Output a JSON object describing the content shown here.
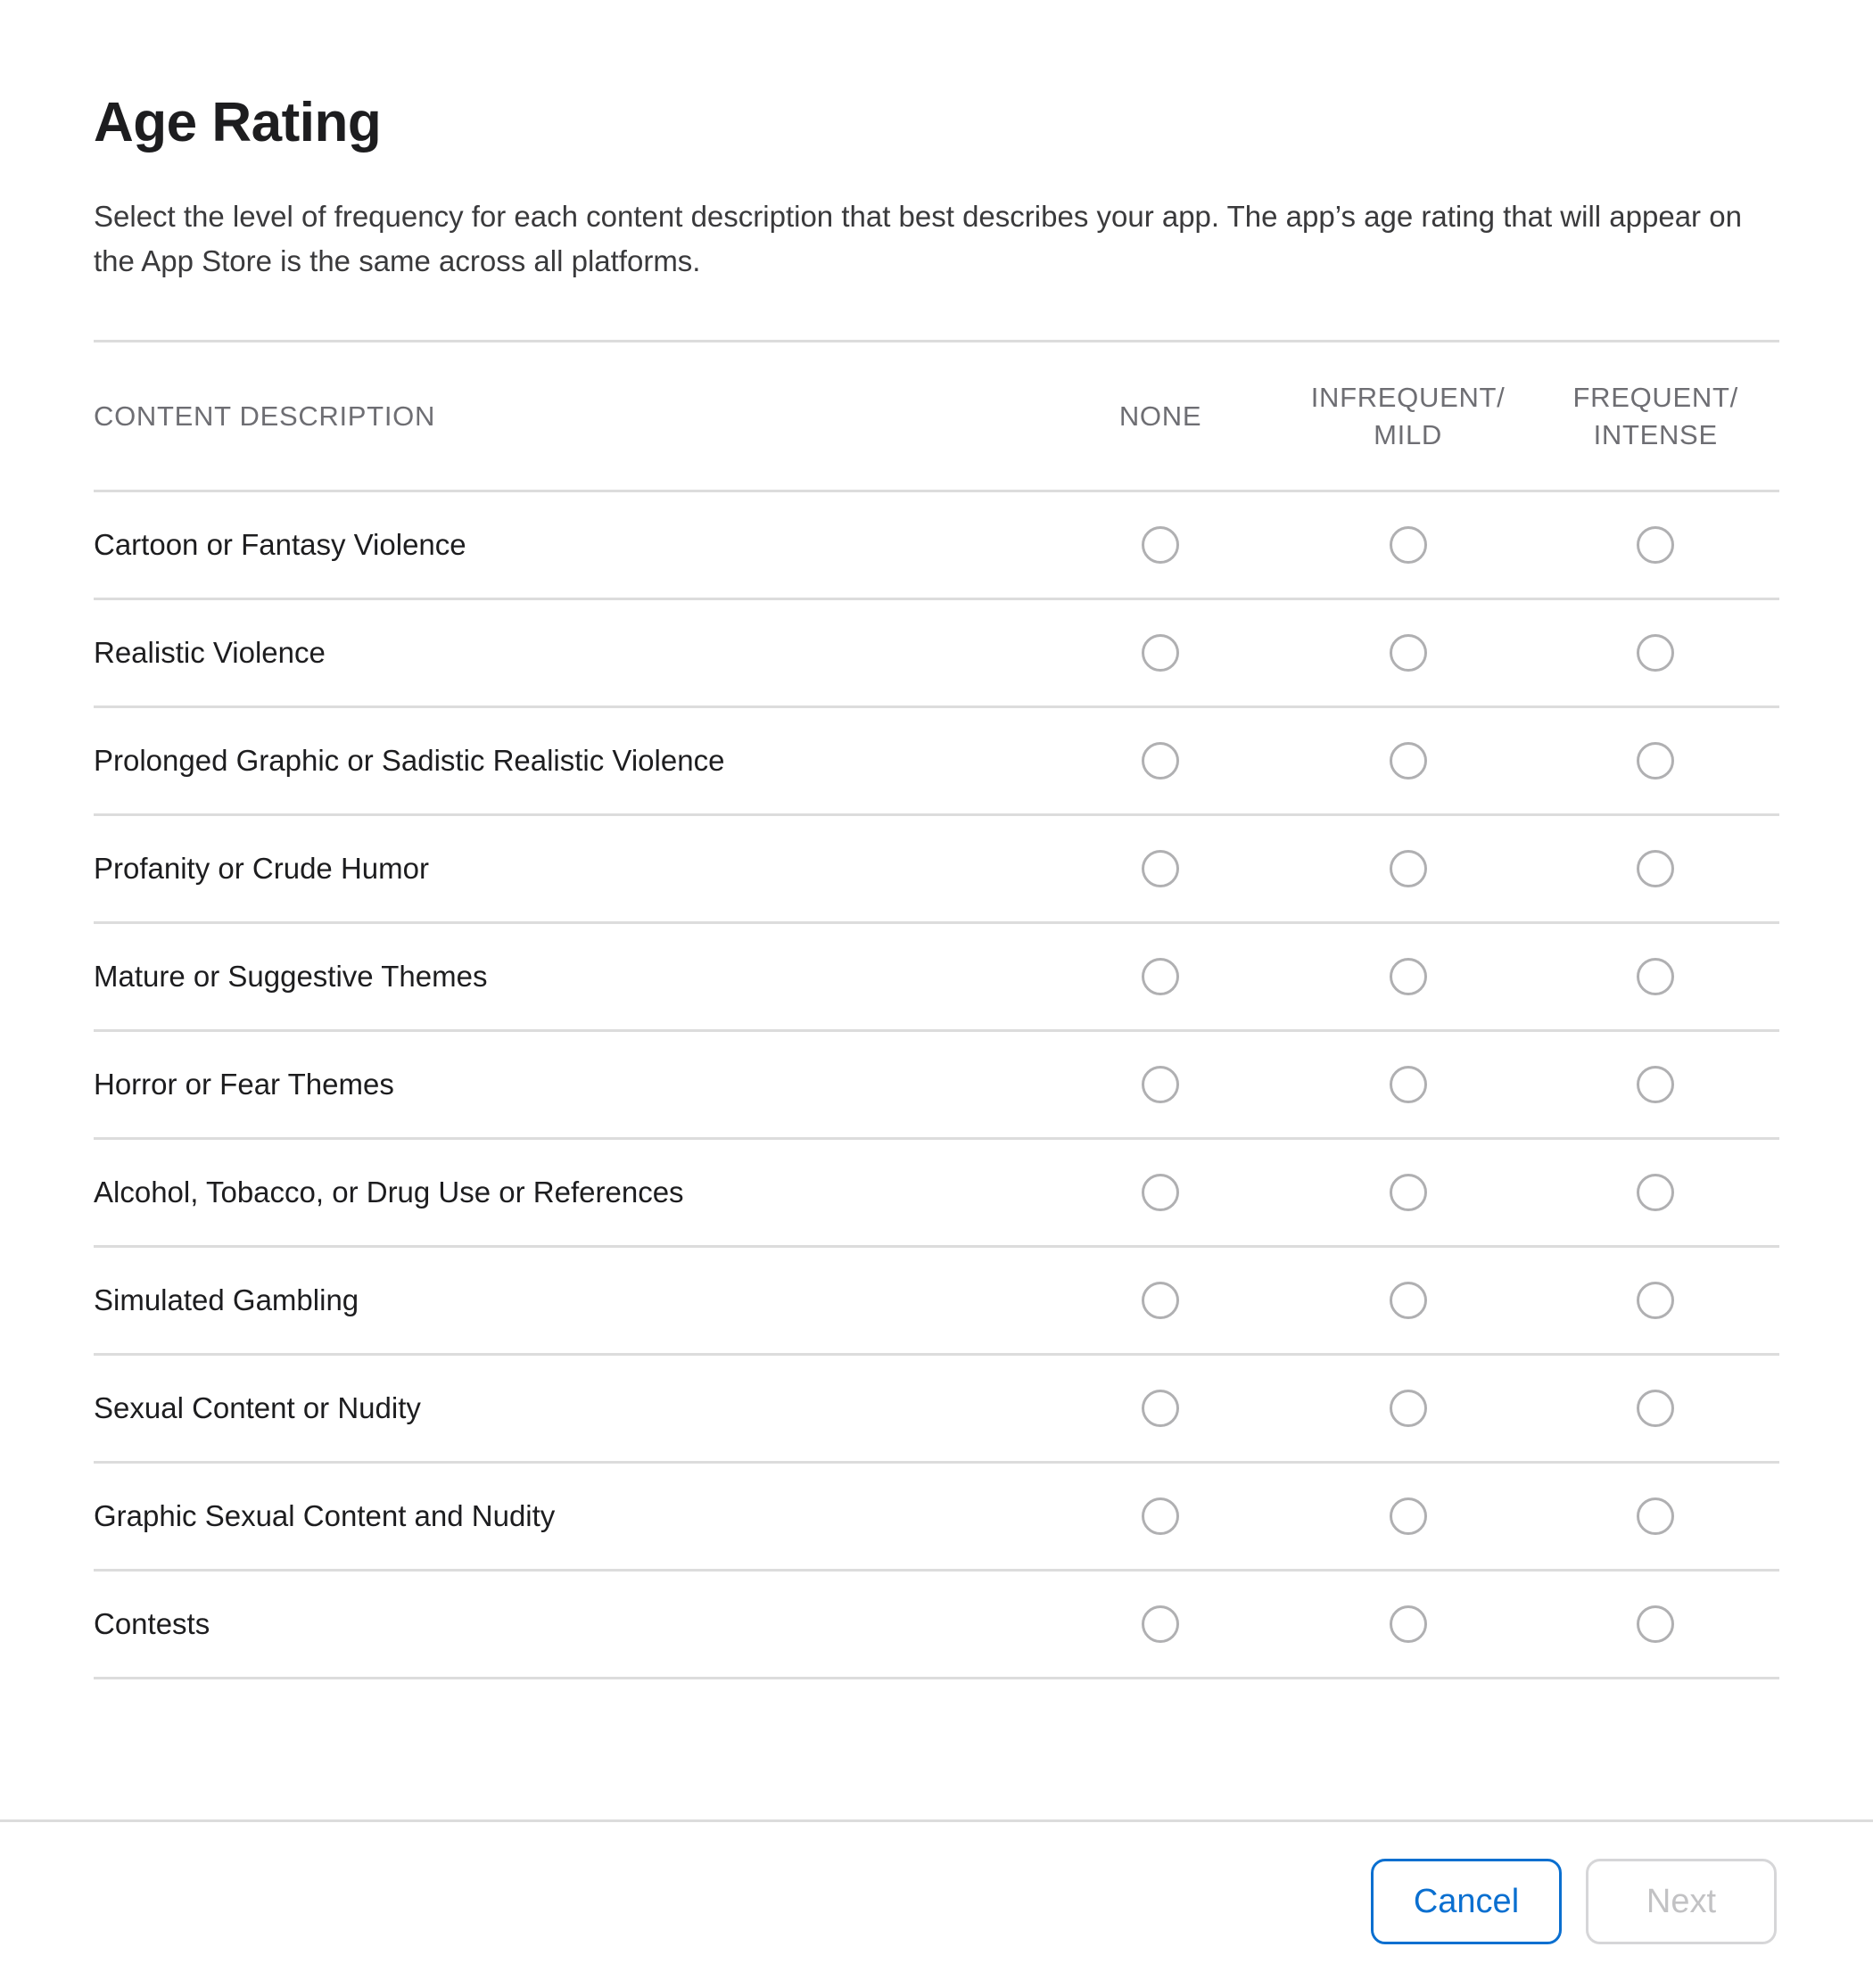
{
  "header": {
    "title": "Age Rating",
    "description": "Select the level of frequency for each content description that best describes your app. The app’s age rating that will appear on the App Store is the same across all platforms."
  },
  "table": {
    "columns": [
      {
        "key": "description",
        "label": "CONTENT DESCRIPTION"
      },
      {
        "key": "none",
        "label": "NONE"
      },
      {
        "key": "infrequent_mild",
        "label_line1": "INFREQUENT/",
        "label_line2": "MILD"
      },
      {
        "key": "frequent_intense",
        "label_line1": "FREQUENT/",
        "label_line2": "INTENSE"
      }
    ],
    "rows": [
      {
        "label": "Cartoon or Fantasy Violence",
        "selected": null
      },
      {
        "label": "Realistic Violence",
        "selected": null
      },
      {
        "label": "Prolonged Graphic or Sadistic Realistic Violence",
        "selected": null
      },
      {
        "label": "Profanity or Crude Humor",
        "selected": null
      },
      {
        "label": "Mature or Suggestive Themes",
        "selected": null
      },
      {
        "label": "Horror or Fear Themes",
        "selected": null
      },
      {
        "label": "Alcohol, Tobacco, or Drug Use or References",
        "selected": null
      },
      {
        "label": "Simulated Gambling",
        "selected": null
      },
      {
        "label": "Sexual Content or Nudity",
        "selected": null
      },
      {
        "label": "Graphic Sexual Content and Nudity",
        "selected": null
      },
      {
        "label": "Contests",
        "selected": null
      }
    ]
  },
  "footer": {
    "cancel_label": "Cancel",
    "next_label": "Next",
    "next_disabled": true
  },
  "colors": {
    "accent_blue": "#0a6fd0",
    "text_primary": "#1d1d1f",
    "text_secondary": "#6e6e73",
    "divider": "#dcdcdc",
    "radio_border": "#b0b0b2",
    "disabled_border": "#d6d6d8",
    "disabled_text": "#c2c2c4"
  }
}
